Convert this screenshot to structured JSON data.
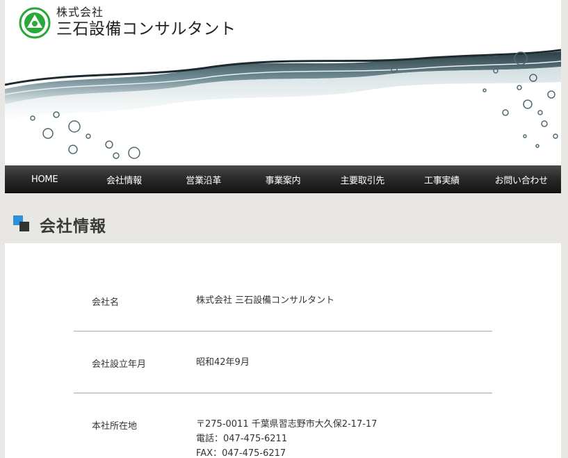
{
  "brand": {
    "line1": "株式会社",
    "line2": "三石設備コンサルタント",
    "accent_color": "#2aa83a"
  },
  "nav": {
    "items": [
      {
        "label": "HOME",
        "name": "nav-home"
      },
      {
        "label": "会社情報",
        "name": "nav-company-info"
      },
      {
        "label": "営業沿革",
        "name": "nav-history"
      },
      {
        "label": "事業案内",
        "name": "nav-business"
      },
      {
        "label": "主要取引先",
        "name": "nav-clients"
      },
      {
        "label": "工事実績",
        "name": "nav-projects"
      },
      {
        "label": "お問い合わせ",
        "name": "nav-contact"
      }
    ]
  },
  "section": {
    "title": "会社情報",
    "icon": "square-bullet-icon"
  },
  "company": {
    "rows": [
      {
        "label": "会社名",
        "values": [
          "株式会社 三石設備コンサルタント"
        ]
      },
      {
        "label": "会社設立年月",
        "values": [
          "昭和42年9月"
        ]
      },
      {
        "label": "本社所在地",
        "values": [
          "〒275-0011 千葉県習志野市大久保2-17-17",
          "電話：047-475-6211",
          "FAX：047-475-6217"
        ]
      }
    ]
  }
}
